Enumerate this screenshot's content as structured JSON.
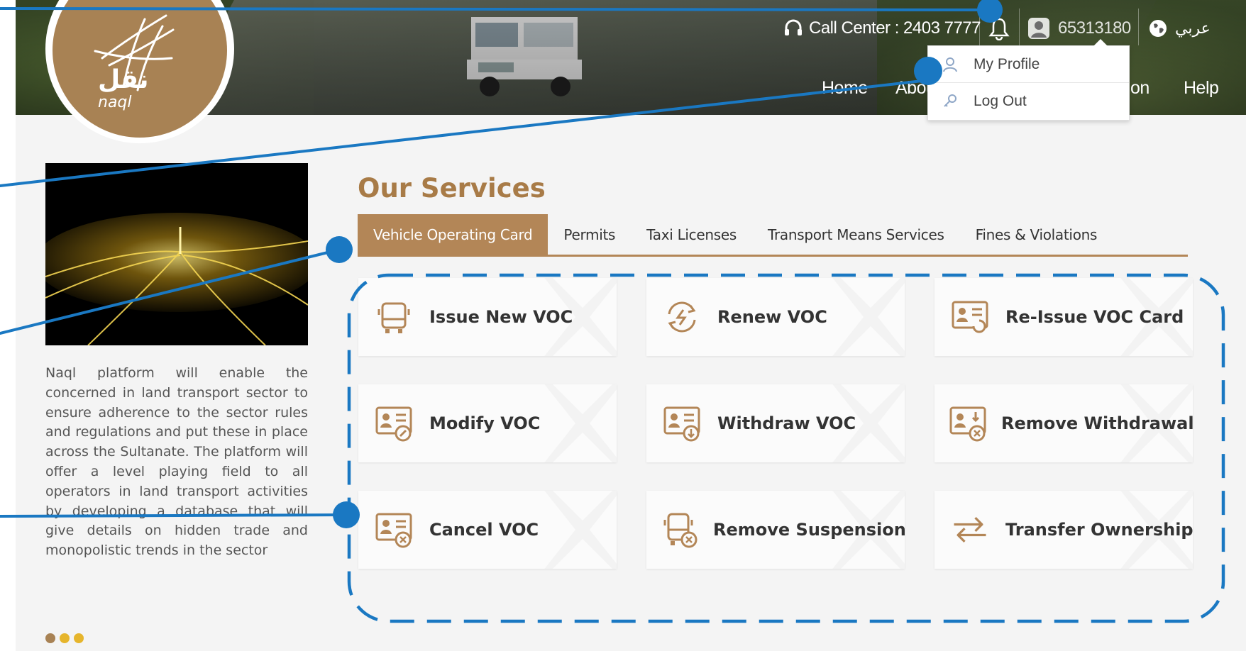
{
  "header": {
    "call_center": "Call Center : 2403 7777",
    "account_number": "65313180",
    "language": "عربي",
    "logo_ar": "نقل",
    "logo_en": "naql",
    "nav": [
      "Home",
      "Abou",
      "on",
      "Help"
    ]
  },
  "dropdown": {
    "items": [
      "My Profile",
      "Log Out"
    ]
  },
  "left": {
    "description": "Naql platform will enable the concerned in land transport sector to ensure adherence to the sector rules and regulations and put these in place across the Sultanate. The platform will offer a level playing field to all operators in land transport activities by developing a database that will give details on hidden trade and monopolistic trends in the sector"
  },
  "services": {
    "title": "Our Services",
    "tabs": [
      "Vehicle Operating Card",
      "Permits",
      "Taxi Licenses",
      "Transport Means Services",
      "Fines & Violations"
    ],
    "active_tab": 0,
    "cards": [
      {
        "label": "Issue New VOC",
        "icon": "bus-icon"
      },
      {
        "label": "Renew VOC",
        "icon": "renew-icon"
      },
      {
        "label": "Re-Issue VOC Card",
        "icon": "reissue-card-icon"
      },
      {
        "label": "Modify VOC",
        "icon": "modify-card-icon"
      },
      {
        "label": "Withdraw VOC",
        "icon": "withdraw-card-icon"
      },
      {
        "label": "Remove Withdrawal",
        "icon": "remove-withdrawal-icon"
      },
      {
        "label": "Cancel VOC",
        "icon": "cancel-card-icon"
      },
      {
        "label": "Remove Suspension",
        "icon": "bus-cancel-icon"
      },
      {
        "label": "Transfer Ownership",
        "icon": "transfer-icon"
      }
    ]
  },
  "colors": {
    "brand": "#b38657",
    "annotation": "#1a78c2",
    "dot_colors": [
      "#a88254",
      "#e6b52c",
      "#e6b52c"
    ]
  }
}
